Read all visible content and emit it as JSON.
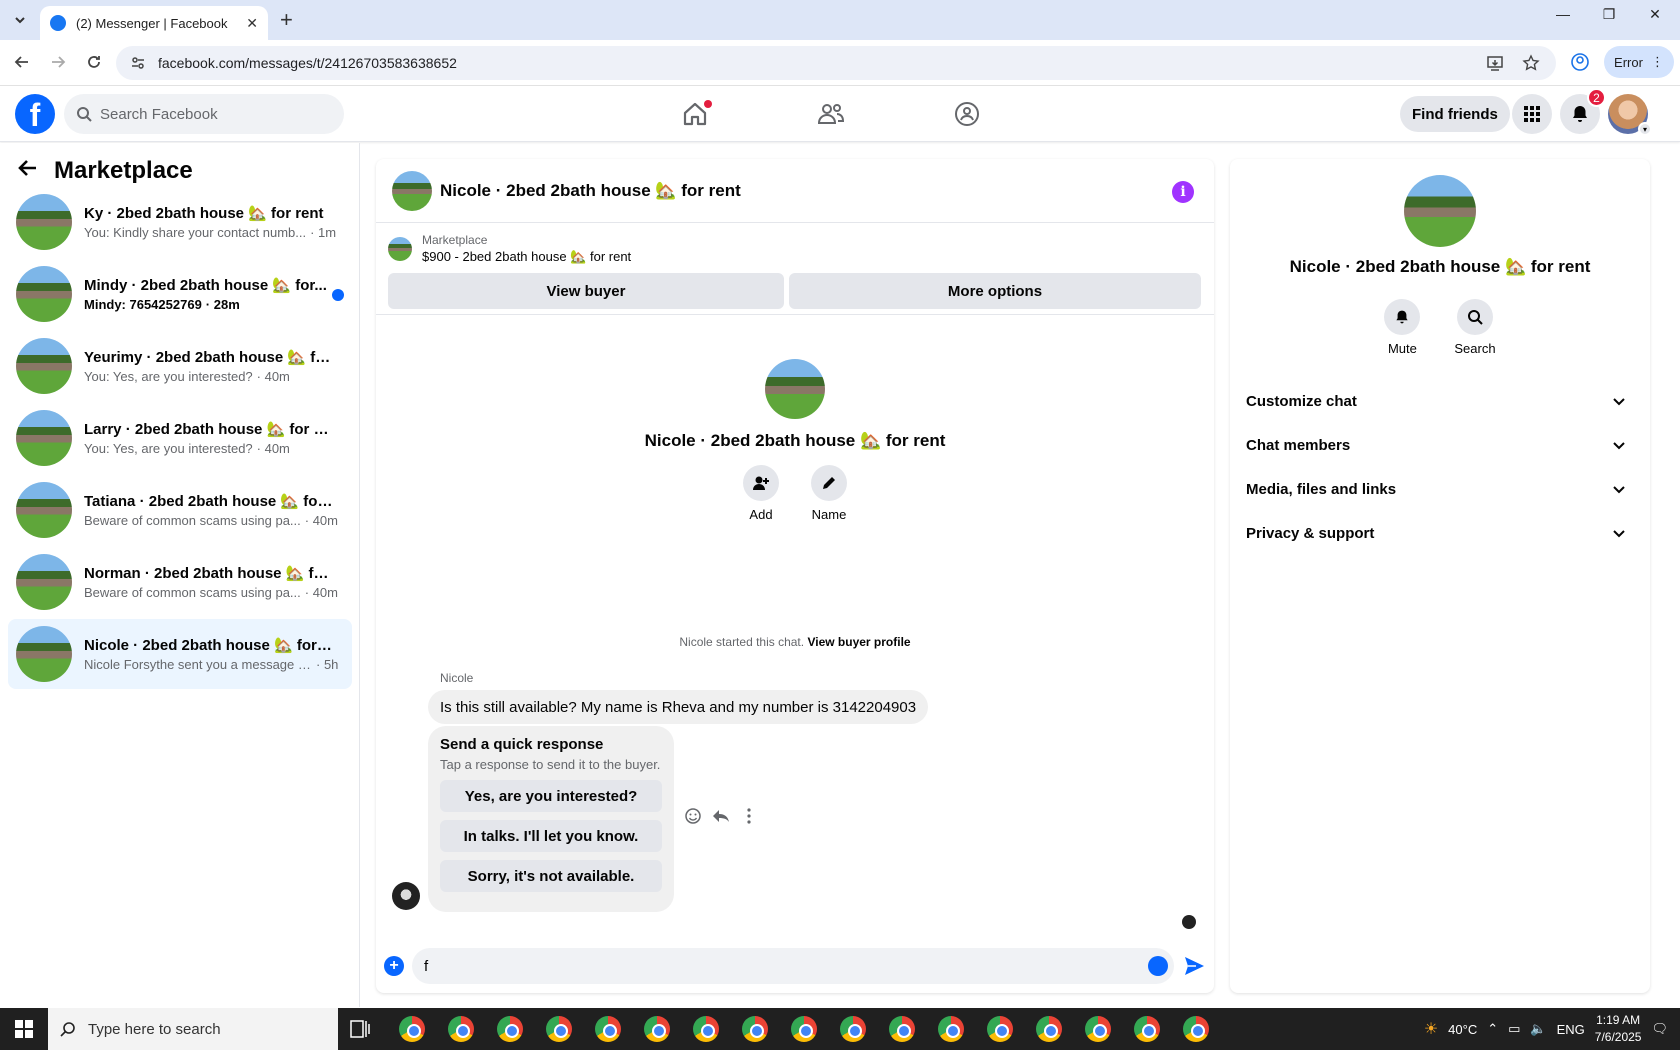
{
  "browser": {
    "tab_title": "(2) Messenger | Facebook",
    "url": "facebook.com/messages/t/24126703583638652",
    "profile_label": "Error"
  },
  "fb": {
    "search_placeholder": "Search Facebook",
    "find_friends": "Find friends",
    "notif_count": "2"
  },
  "sidebar": {
    "title": "Marketplace",
    "conversations": [
      {
        "name": "Ky · 2bed 2bath house 🏡 for rent",
        "snippet": "You: Kindly share your contact numb...",
        "time": "· 1m",
        "unread": false
      },
      {
        "name": "Mindy · 2bed 2bath house 🏡 for...",
        "snippet": "Mindy: 7654252769",
        "time": "· 28m",
        "unread": true
      },
      {
        "name": "Yeurimy · 2bed 2bath house 🏡 for...",
        "snippet": "You: Yes, are you interested?",
        "time": "· 40m",
        "unread": false
      },
      {
        "name": "Larry · 2bed 2bath house 🏡 for rent",
        "snippet": "You: Yes, are you interested?",
        "time": "· 40m",
        "unread": false
      },
      {
        "name": "Tatiana · 2bed 2bath house 🏡 for ...",
        "snippet": "Beware of common scams using pa...",
        "time": "· 40m",
        "unread": false
      },
      {
        "name": "Norman · 2bed 2bath house 🏡 fo...",
        "snippet": "Beware of common scams using pa...",
        "time": "· 40m",
        "unread": false
      },
      {
        "name": "Nicole · 2bed 2bath house 🏡 for r...",
        "snippet": "Nicole Forsythe sent you a message a...",
        "time": "· 5h",
        "unread": false
      }
    ]
  },
  "chat": {
    "title": "Nicole · 2bed 2bath house 🏡 for rent",
    "marketplace_label": "Marketplace",
    "listing": "$900 - 2bed 2bath house 🏡 for rent",
    "view_buyer": "View buyer",
    "more_options": "More options",
    "intro_name": "Nicole · 2bed 2bath house 🏡 for rent",
    "add_label": "Add",
    "name_label": "Name",
    "started_text": "Nicole started this chat.",
    "view_buyer_profile": "View buyer profile",
    "sender": "Nicole",
    "message": "Is this still available? My name is Rheva and my number is 3142204903",
    "quick_title": "Send a quick response",
    "quick_sub": "Tap a response to send it to the buyer.",
    "quick_options": [
      "Yes, are you interested?",
      "In talks. I'll let you know.",
      "Sorry, it's not available."
    ],
    "composer_value": "f"
  },
  "info": {
    "name": "Nicole · 2bed 2bath house 🏡 for rent",
    "mute": "Mute",
    "search": "Search",
    "sections": [
      "Customize chat",
      "Chat members",
      "Media, files and links",
      "Privacy & support"
    ]
  },
  "taskbar": {
    "search_placeholder": "Type here to search",
    "temp": "40°C",
    "lang": "ENG",
    "time": "1:19 AM",
    "date": "7/6/2025"
  }
}
